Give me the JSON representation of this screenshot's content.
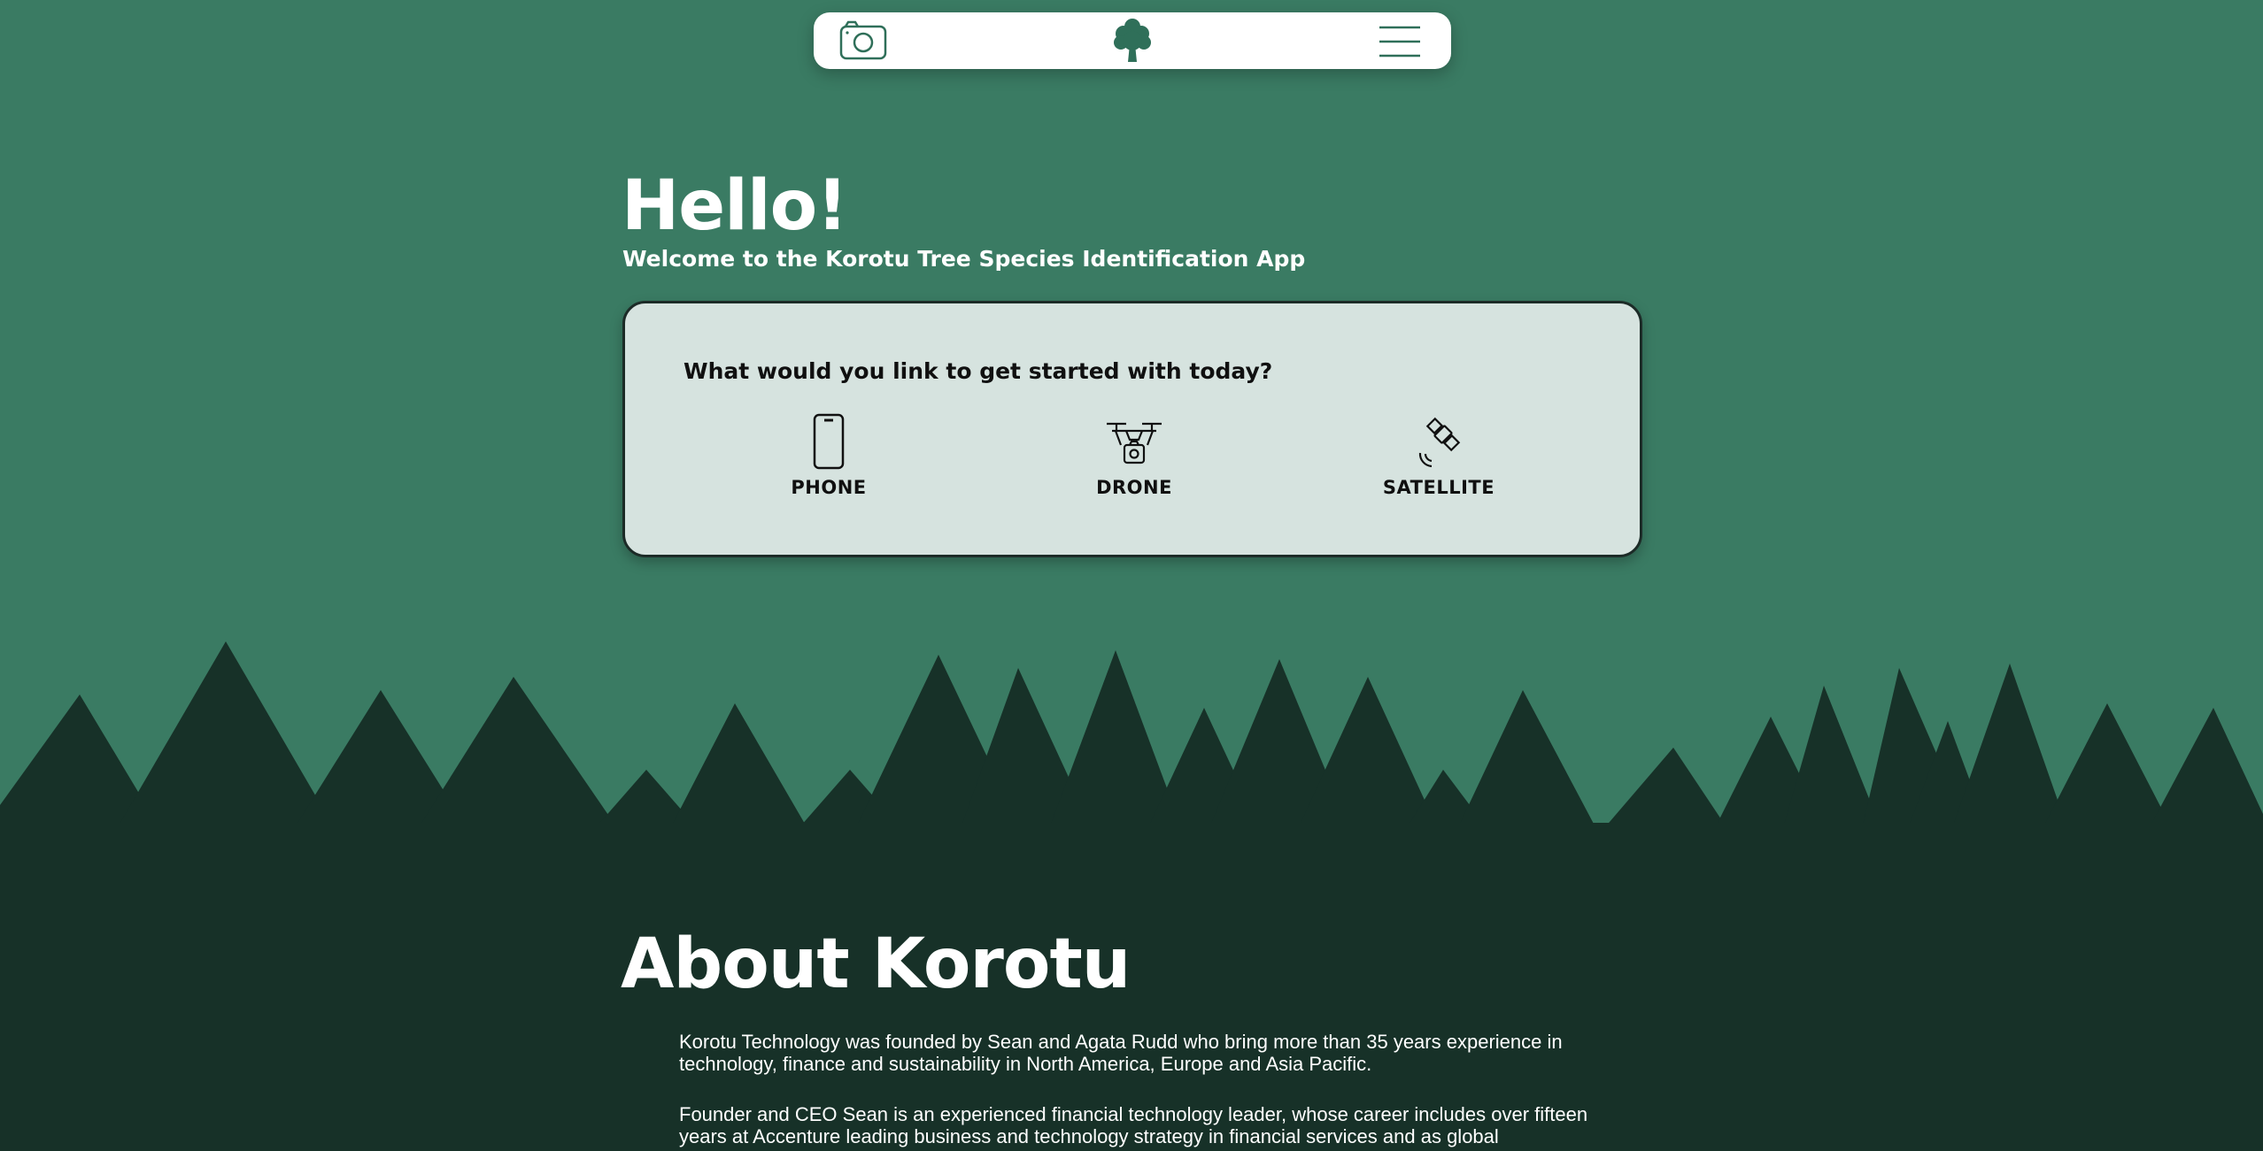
{
  "nav": {
    "camera_icon": "camera-icon",
    "logo_icon": "tree-logo-icon",
    "menu_icon": "hamburger-menu-icon",
    "white": "#ffffff",
    "accent": "#2f6f59"
  },
  "hero": {
    "title": "Hello!",
    "subtitle": "Welcome to the Korotu Tree Species Identification App"
  },
  "card": {
    "question": "What would you link to get started with today?",
    "options": [
      {
        "label": "PHONE",
        "icon": "phone-icon"
      },
      {
        "label": "DRONE",
        "icon": "drone-icon"
      },
      {
        "label": "SATELLITE",
        "icon": "satellite-icon"
      }
    ]
  },
  "about": {
    "title": "About Korotu",
    "paragraphs": [
      "Korotu Technology was founded by Sean and Agata Rudd who bring more than 35 years experience in technology, finance and sustainability in North America, Europe and Asia Pacific.",
      "Founder and CEO Sean is an experienced financial technology leader, whose career includes over fifteen years at Accenture leading business and technology strategy in financial services and as global"
    ]
  },
  "colors": {
    "background": "#3a7b63",
    "forest": "#173128",
    "card": "#d6e3df"
  }
}
